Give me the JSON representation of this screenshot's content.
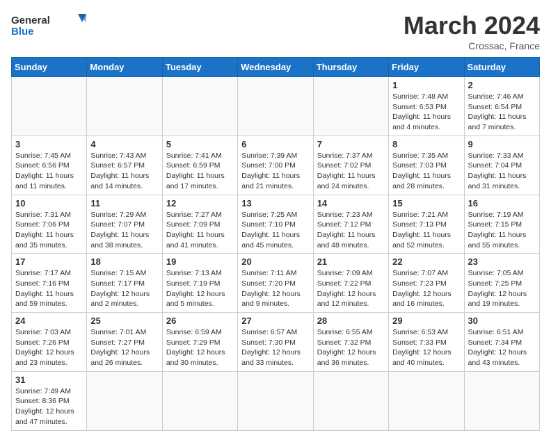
{
  "header": {
    "logo_general": "General",
    "logo_blue": "Blue",
    "month_title": "March 2024",
    "location": "Crossac, France"
  },
  "weekdays": [
    "Sunday",
    "Monday",
    "Tuesday",
    "Wednesday",
    "Thursday",
    "Friday",
    "Saturday"
  ],
  "days": {
    "d1": {
      "num": "1",
      "sunrise": "7:48 AM",
      "sunset": "6:53 PM",
      "daylight": "11 hours and 4 minutes."
    },
    "d2": {
      "num": "2",
      "sunrise": "7:46 AM",
      "sunset": "6:54 PM",
      "daylight": "11 hours and 7 minutes."
    },
    "d3": {
      "num": "3",
      "sunrise": "7:45 AM",
      "sunset": "6:56 PM",
      "daylight": "11 hours and 11 minutes."
    },
    "d4": {
      "num": "4",
      "sunrise": "7:43 AM",
      "sunset": "6:57 PM",
      "daylight": "11 hours and 14 minutes."
    },
    "d5": {
      "num": "5",
      "sunrise": "7:41 AM",
      "sunset": "6:59 PM",
      "daylight": "11 hours and 17 minutes."
    },
    "d6": {
      "num": "6",
      "sunrise": "7:39 AM",
      "sunset": "7:00 PM",
      "daylight": "11 hours and 21 minutes."
    },
    "d7": {
      "num": "7",
      "sunrise": "7:37 AM",
      "sunset": "7:02 PM",
      "daylight": "11 hours and 24 minutes."
    },
    "d8": {
      "num": "8",
      "sunrise": "7:35 AM",
      "sunset": "7:03 PM",
      "daylight": "11 hours and 28 minutes."
    },
    "d9": {
      "num": "9",
      "sunrise": "7:33 AM",
      "sunset": "7:04 PM",
      "daylight": "11 hours and 31 minutes."
    },
    "d10": {
      "num": "10",
      "sunrise": "7:31 AM",
      "sunset": "7:06 PM",
      "daylight": "11 hours and 35 minutes."
    },
    "d11": {
      "num": "11",
      "sunrise": "7:29 AM",
      "sunset": "7:07 PM",
      "daylight": "11 hours and 38 minutes."
    },
    "d12": {
      "num": "12",
      "sunrise": "7:27 AM",
      "sunset": "7:09 PM",
      "daylight": "11 hours and 41 minutes."
    },
    "d13": {
      "num": "13",
      "sunrise": "7:25 AM",
      "sunset": "7:10 PM",
      "daylight": "11 hours and 45 minutes."
    },
    "d14": {
      "num": "14",
      "sunrise": "7:23 AM",
      "sunset": "7:12 PM",
      "daylight": "11 hours and 48 minutes."
    },
    "d15": {
      "num": "15",
      "sunrise": "7:21 AM",
      "sunset": "7:13 PM",
      "daylight": "11 hours and 52 minutes."
    },
    "d16": {
      "num": "16",
      "sunrise": "7:19 AM",
      "sunset": "7:15 PM",
      "daylight": "11 hours and 55 minutes."
    },
    "d17": {
      "num": "17",
      "sunrise": "7:17 AM",
      "sunset": "7:16 PM",
      "daylight": "11 hours and 59 minutes."
    },
    "d18": {
      "num": "18",
      "sunrise": "7:15 AM",
      "sunset": "7:17 PM",
      "daylight": "12 hours and 2 minutes."
    },
    "d19": {
      "num": "19",
      "sunrise": "7:13 AM",
      "sunset": "7:19 PM",
      "daylight": "12 hours and 5 minutes."
    },
    "d20": {
      "num": "20",
      "sunrise": "7:11 AM",
      "sunset": "7:20 PM",
      "daylight": "12 hours and 9 minutes."
    },
    "d21": {
      "num": "21",
      "sunrise": "7:09 AM",
      "sunset": "7:22 PM",
      "daylight": "12 hours and 12 minutes."
    },
    "d22": {
      "num": "22",
      "sunrise": "7:07 AM",
      "sunset": "7:23 PM",
      "daylight": "12 hours and 16 minutes."
    },
    "d23": {
      "num": "23",
      "sunrise": "7:05 AM",
      "sunset": "7:25 PM",
      "daylight": "12 hours and 19 minutes."
    },
    "d24": {
      "num": "24",
      "sunrise": "7:03 AM",
      "sunset": "7:26 PM",
      "daylight": "12 hours and 23 minutes."
    },
    "d25": {
      "num": "25",
      "sunrise": "7:01 AM",
      "sunset": "7:27 PM",
      "daylight": "12 hours and 26 minutes."
    },
    "d26": {
      "num": "26",
      "sunrise": "6:59 AM",
      "sunset": "7:29 PM",
      "daylight": "12 hours and 30 minutes."
    },
    "d27": {
      "num": "27",
      "sunrise": "6:57 AM",
      "sunset": "7:30 PM",
      "daylight": "12 hours and 33 minutes."
    },
    "d28": {
      "num": "28",
      "sunrise": "6:55 AM",
      "sunset": "7:32 PM",
      "daylight": "12 hours and 36 minutes."
    },
    "d29": {
      "num": "29",
      "sunrise": "6:53 AM",
      "sunset": "7:33 PM",
      "daylight": "12 hours and 40 minutes."
    },
    "d30": {
      "num": "30",
      "sunrise": "6:51 AM",
      "sunset": "7:34 PM",
      "daylight": "12 hours and 43 minutes."
    },
    "d31": {
      "num": "31",
      "sunrise": "7:49 AM",
      "sunset": "8:36 PM",
      "daylight": "12 hours and 47 minutes."
    }
  }
}
